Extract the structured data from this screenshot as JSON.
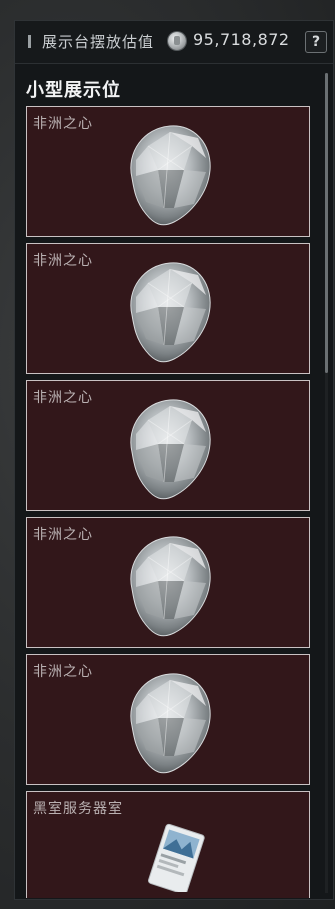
{
  "header": {
    "label": "展示台摆放估值",
    "value": "95,718,872",
    "help_symbol": "?",
    "coin_icon": "silver-coin-icon"
  },
  "section": {
    "title": "小型展示位"
  },
  "slots": [
    {
      "name": "非洲之心",
      "icon": "diamond-gem-icon"
    },
    {
      "name": "非洲之心",
      "icon": "diamond-gem-icon"
    },
    {
      "name": "非洲之心",
      "icon": "diamond-gem-icon"
    },
    {
      "name": "非洲之心",
      "icon": "diamond-gem-icon"
    },
    {
      "name": "非洲之心",
      "icon": "diamond-gem-icon"
    },
    {
      "name": "黑室服务器室",
      "icon": "keycard-icon"
    }
  ],
  "colors": {
    "slot_background": "#32171a",
    "slot_border": "#c9c2c3",
    "panel_background": "#141719"
  }
}
